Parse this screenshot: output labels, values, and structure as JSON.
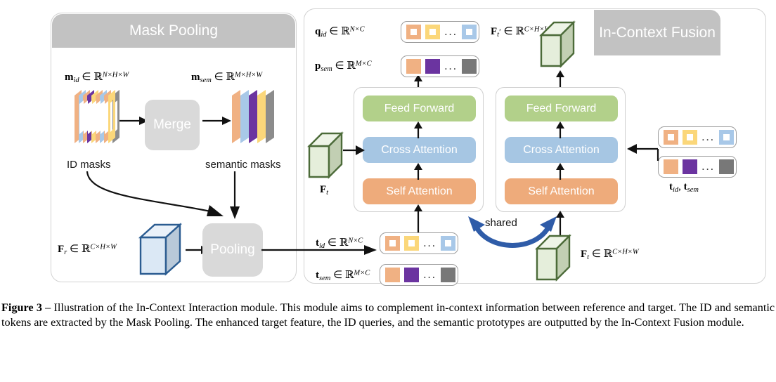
{
  "figure": {
    "panels": {
      "mask_pooling": {
        "title": "Mask Pooling"
      },
      "in_context_fusion": {
        "title": "In-Context Fusion"
      }
    },
    "mask_pooling": {
      "id_masks_label": "m_id ∈ R^{N×H×W}",
      "id_masks_caption": "ID masks",
      "semantic_masks_label": "m_sem ∈ R^{M×H×W}",
      "semantic_masks_caption": "semantic masks",
      "merge_label": "Merge",
      "pooling_label": "Pooling",
      "reference_feature_label": "F_r ∈ R^{C×H×W}",
      "id_mask_colors": [
        "#f0b183",
        "#a8c8e8",
        "#6b34a0",
        "#fbd77a",
        "#8c8c8c"
      ],
      "semantic_mask_colors": [
        "#f0b183",
        "#a8c8e8",
        "#6b34a0",
        "#fbd77a",
        "#8c8c8c"
      ],
      "reference_cube_color": "#dbe8f5",
      "reference_cube_stroke": "#2b5c91"
    },
    "fusion": {
      "q_id_label": "q_id ∈ R^{N×C}",
      "p_sem_label": "p_sem ∈ R^{M×C}",
      "ft_prime_label": "F'_t ∈ R^{C×H×W}",
      "t_id_label": "t_id ∈ R^{N×C}",
      "t_sem_label": "t_sem ∈ R^{M×C}",
      "ft_label": "F_t",
      "ft_full_label": "F_t ∈ R^{C×H×W}",
      "t_id_t_sem_label": "t_id, t_sem",
      "shared_label": "shared",
      "shared_arrow_color": "#2f5ca8",
      "target_cube_color": "#dfe8d5",
      "target_cube_stroke": "#4c6b39",
      "layers": [
        {
          "name": "feed-forward",
          "label": "Feed Forward",
          "color": "#b2d08a"
        },
        {
          "name": "cross-attention",
          "label": "Cross Attention",
          "color": "#a6c6e3"
        },
        {
          "name": "self-attention",
          "label": "Self Attention",
          "color": "#eeab7b"
        }
      ]
    },
    "tokens": {
      "id_tokens": [
        "#f0b183",
        "#fbd77a",
        "...",
        "#a8c8e8"
      ],
      "sem_tokens": [
        "#f0b183",
        "#6b34a0",
        "...",
        "#787878"
      ],
      "ellipsis": "..."
    }
  },
  "caption": {
    "label": "Figure 3",
    "dash": " – ",
    "text": "Illustration of the In-Context Interaction module. This module aims to complement in-context information between reference and target. The ID and semantic tokens are extracted by the Mask Pooling. The enhanced target feature, the ID queries, and the semantic prototypes are outputted by the In-Context Fusion module."
  }
}
